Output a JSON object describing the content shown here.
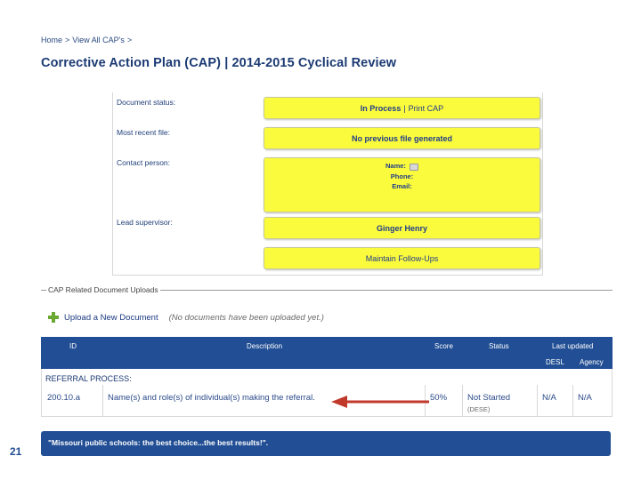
{
  "breadcrumb": {
    "home": "Home",
    "sep1": ">",
    "view_all": "View All CAP's",
    "sep2": ">"
  },
  "page_title": "Corrective Action Plan (CAP) | 2014-2015 Cyclical Review",
  "fields": {
    "document_status": {
      "label": "Document status:",
      "in_process": "In Process",
      "separator": "|",
      "print": "Print CAP"
    },
    "most_recent_file": {
      "label": "Most recent file:",
      "value": "No previous file generated"
    },
    "contact_person": {
      "label": "Contact person:",
      "name_label": "Name:",
      "phone_label": "Phone:",
      "email_label": "Email:"
    },
    "lead_supervisor": {
      "label": "Lead supervisor:",
      "value": "Ginger Henry"
    },
    "follow_ups": {
      "label": "Maintain Follow-Ups"
    }
  },
  "uploads": {
    "legend": "CAP Related Document Uploads",
    "upload_link": "Upload a New Document",
    "empty_note": "(No documents have been uploaded yet.)"
  },
  "table": {
    "headers": {
      "id": "ID",
      "description": "Description",
      "score": "Score",
      "status": "Status",
      "last_updated": "Last updated",
      "desl": "DESL",
      "agency": "Agency"
    },
    "group": "REFERRAL PROCESS:",
    "rows": [
      {
        "id": "200.10.a",
        "description": "Name(s) and role(s) of individual(s) making the referral.",
        "score": "50%",
        "status": "Not Started",
        "status_sub": "(DESE)",
        "desl": "N/A",
        "agency": "N/A"
      }
    ]
  },
  "footer": {
    "text": "\"Missouri public schools: the best choice...the best results!\"."
  },
  "slide_number": "21",
  "colors": {
    "header_blue": "#214e94",
    "highlight_yellow": "#fbfb3d",
    "arrow_red": "#c0392b"
  }
}
